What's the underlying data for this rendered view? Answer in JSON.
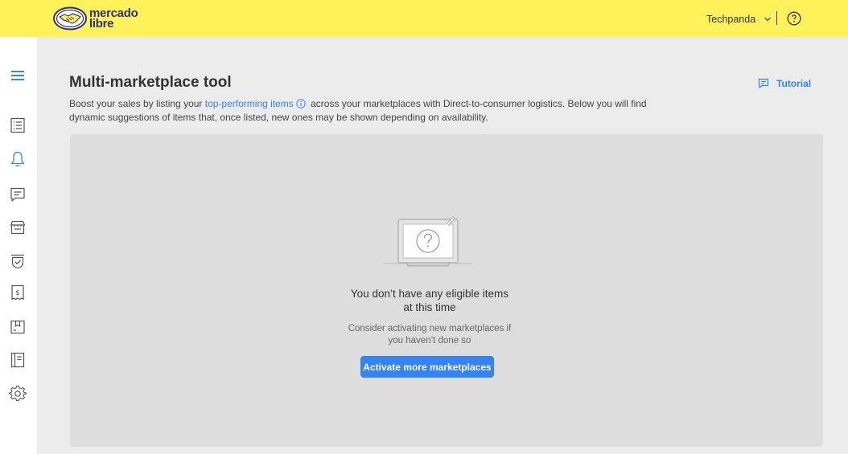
{
  "header": {
    "brand_line1": "mercado",
    "brand_line2": "libre",
    "user_name": "Techpanda",
    "icons": [
      "handshake-logo-icon",
      "chevron-down-icon",
      "help-icon"
    ]
  },
  "sidebar": {
    "items": [
      {
        "name": "menu",
        "icon": "hamburger-icon"
      },
      {
        "name": "listings",
        "icon": "list-icon"
      },
      {
        "name": "notifications",
        "icon": "bell-icon"
      },
      {
        "name": "messages",
        "icon": "chat-icon"
      },
      {
        "name": "store",
        "icon": "store-icon"
      },
      {
        "name": "reputation",
        "icon": "badge-check-icon"
      },
      {
        "name": "billing",
        "icon": "receipt-dollar-icon"
      },
      {
        "name": "shipping",
        "icon": "box-icon"
      },
      {
        "name": "reports",
        "icon": "book-icon"
      },
      {
        "name": "settings",
        "icon": "gear-icon"
      }
    ]
  },
  "main": {
    "title": "Multi-marketplace tool",
    "tutorial_label": "Tutorial",
    "description": {
      "before": "Boost your sales by listing your ",
      "link": "top-performing items",
      "after": " across your marketplaces with Direct-to-consumer logistics. Below you will find dynamic suggestions of items that, once listed, new ones may be shown depending on availability."
    },
    "empty_state": {
      "title": "You don’t have any eligible items at this time",
      "subtitle": "Consider activating new marketplaces if you haven’t done so",
      "button_label": "Activate more marketplaces"
    }
  },
  "colors": {
    "header_bg": "#fff159",
    "accent": "#3483fa",
    "brand_navy": "#2d3277",
    "page_bg": "#ebebeb",
    "panel_bg": "#dddddd"
  }
}
